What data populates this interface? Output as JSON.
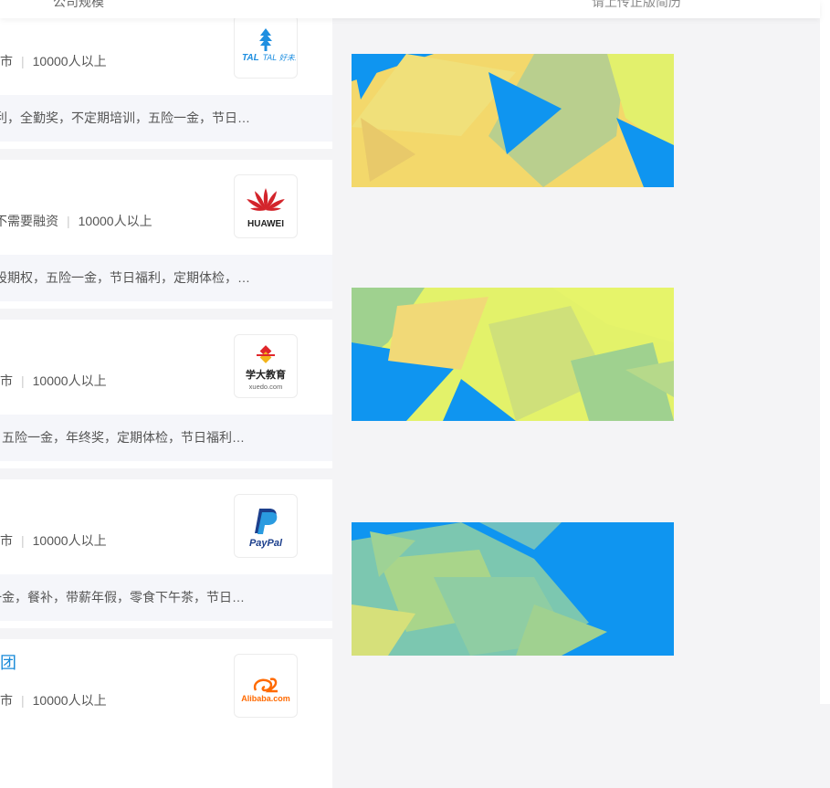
{
  "topbar": {
    "left_label": "公司规模",
    "right_label": "请上传正版简历"
  },
  "companies": [
    {
      "meta": [
        "市",
        "10000人以上"
      ],
      "welfare": "利，全勤奖，不定期培训，五险一金，节日…",
      "logo_name": "TAL 好未来",
      "logo_icon": "tal-logo-icon"
    },
    {
      "meta": [
        "不需要融资",
        "10000人以上"
      ],
      "welfare": "股期权，五险一金，节日福利，定期体检，…",
      "logo_name": "HUAWEI",
      "logo_icon": "huawei-logo-icon"
    },
    {
      "meta": [
        "上市",
        "10000人以上"
      ],
      "welfare": "，五险一金，年终奖，定期体检，节日福利…",
      "logo_name": "学大教育",
      "logo_sub": "xuedo.com",
      "logo_icon": "xueda-logo-icon"
    },
    {
      "meta": [
        "市",
        "10000人以上"
      ],
      "welfare": "一金，餐补，带薪年假，零食下午茶，节日…",
      "logo_name": "PayPal",
      "logo_icon": "paypal-logo-icon"
    },
    {
      "title": "团",
      "meta": [
        "市",
        "10000人以上"
      ],
      "welfare": "",
      "logo_name": "Alibaba.com",
      "logo_icon": "alibaba-logo-icon"
    }
  ],
  "banners": [
    {
      "name": "ad-banner-1",
      "colors": [
        "#0f95f0",
        "#f3d86b",
        "#e2f06c",
        "#b9cf8e"
      ]
    },
    {
      "name": "ad-banner-2",
      "colors": [
        "#e3f26a",
        "#0f95f0",
        "#f1d977",
        "#9fd18f"
      ]
    },
    {
      "name": "ad-banner-3",
      "colors": [
        "#0f95f0",
        "#7cc7b0",
        "#a9d58a",
        "#d6e07a"
      ]
    }
  ]
}
